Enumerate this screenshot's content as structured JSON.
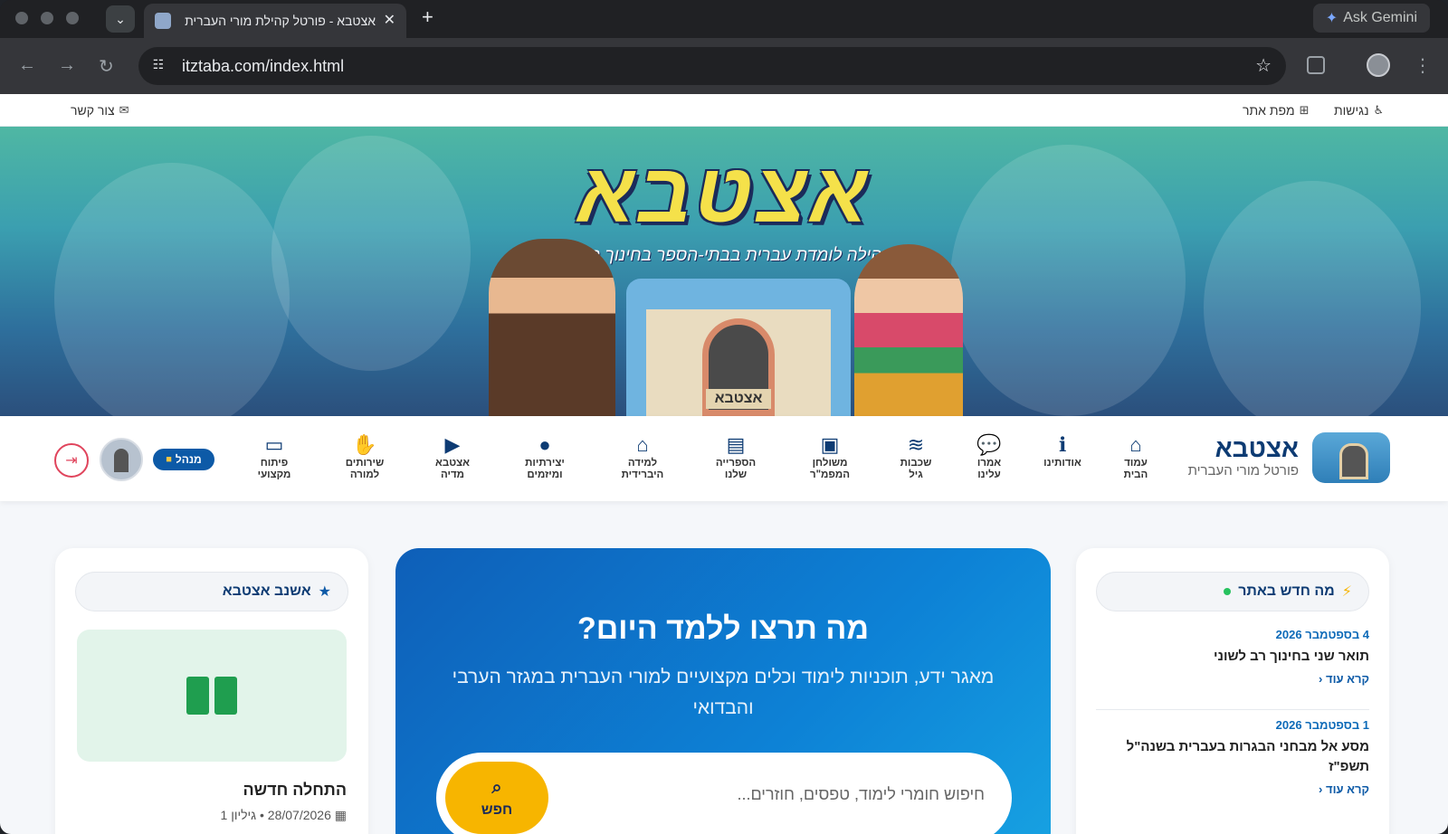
{
  "browser": {
    "tab_title": "אצטבא - פורטל קהילת מורי העברית",
    "new_tab": "+",
    "close": "✕",
    "gemini_label": "Ask Gemini",
    "url": "itztaba.com/index.html"
  },
  "util_bar": {
    "contact": "צור קשר",
    "sitemap": "מפת אתר",
    "accessibility": "נגישות"
  },
  "hero": {
    "logo": "אצטבא",
    "slogan": "\"קהילה לומדת עברית בבתי-הספר בחינוך הערבי\"",
    "gate_sign": "אצטבא"
  },
  "nav": {
    "brand_name": "אצטבא",
    "brand_sub": "פורטל מורי העברית",
    "items": [
      {
        "line1": "עמוד",
        "line2": "הבית",
        "icon": "⌂"
      },
      {
        "line1": "אודותינו",
        "line2": "",
        "icon": "ℹ"
      },
      {
        "line1": "אמרו",
        "line2": "עלינו",
        "icon": "💬"
      },
      {
        "line1": "שכבות",
        "line2": "גיל",
        "icon": "≋"
      },
      {
        "line1": "משולחן",
        "line2": "המפמ\"ר",
        "icon": "▣"
      },
      {
        "line1": "הספרייה",
        "line2": "שלנו",
        "icon": "▤"
      },
      {
        "line1": "למידה",
        "line2": "היברידית",
        "icon": "⌂"
      },
      {
        "line1": "יצירתיות",
        "line2": "ומיזמים",
        "icon": "●"
      },
      {
        "line1": "אצטבא",
        "line2": "מדיה",
        "icon": "▶"
      },
      {
        "line1": "שירותים",
        "line2": "למורה",
        "icon": "✋"
      },
      {
        "line1": "פיתוח",
        "line2": "מקצועי",
        "icon": "▭"
      }
    ],
    "admin_badge": "מנהל",
    "logout_icon": "logout-icon"
  },
  "whats_new": {
    "title": "מה חדש באתר",
    "items": [
      {
        "date": "4 בספטמבר 2026",
        "title": "תואר שני בחינוך רב לשוני",
        "read_more": "קרא עוד"
      },
      {
        "date": "1 בספטמבר 2026",
        "title": "מסע אל מבחני הבגרות בעברית בשנה\"ל תשפ\"ז",
        "read_more": "קרא עוד"
      }
    ]
  },
  "main_hero": {
    "title": "מה תרצו ללמד היום?",
    "subtitle": "מאגר ידע, תוכניות לימוד וכלים מקצועיים למורי העברית במגזר הערבי והבדואי",
    "search_placeholder": "חיפוש חומרי לימוד, טפסים, חוזרים...",
    "search_button": "חפש"
  },
  "newsletter": {
    "title": "אשנב אצטבא",
    "post_title": "התחלה חדשה",
    "post_date": "28/07/2026",
    "post_issue": "גיליון 1"
  }
}
